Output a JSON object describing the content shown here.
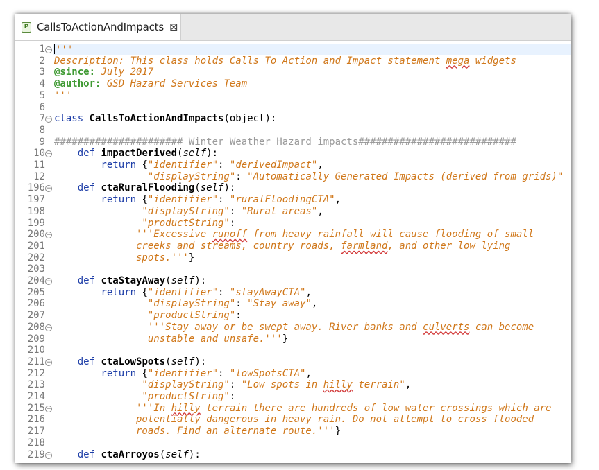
{
  "tab": {
    "title": "CallsToActionAndImpacts",
    "icon": "P",
    "close": "⊠"
  },
  "lines": [
    {
      "n": "1",
      "fold": true,
      "cur": true,
      "s": [
        {
          "t": "'''",
          "c": "str"
        }
      ]
    },
    {
      "n": "2",
      "s": [
        {
          "t": "Description: This class holds Calls To Action and Impact statement mega widgets",
          "c": "str"
        }
      ]
    },
    {
      "n": "3",
      "s": [
        {
          "t": "@since:",
          "c": "tag"
        },
        {
          "t": " July 2017",
          "c": "str"
        }
      ]
    },
    {
      "n": "4",
      "s": [
        {
          "t": "@author:",
          "c": "tag"
        },
        {
          "t": " GSD Hazard Services Team",
          "c": "str"
        }
      ]
    },
    {
      "n": "5",
      "s": [
        {
          "t": "'''",
          "c": "str"
        }
      ]
    },
    {
      "n": "6",
      "s": []
    },
    {
      "n": "7",
      "fold": true,
      "s": [
        {
          "t": "class ",
          "c": "kw"
        },
        {
          "t": "CallsToActionAndImpacts",
          "c": "fn"
        },
        {
          "t": "(object):",
          "c": "dflt"
        }
      ]
    },
    {
      "n": "8",
      "s": []
    },
    {
      "n": "9",
      "s": [
        {
          "t": "###################### Winter Weather Hazard impacts###########################",
          "c": "cmt"
        }
      ]
    },
    {
      "n": "10",
      "fold": true,
      "s": [
        {
          "t": "    def ",
          "c": "kw"
        },
        {
          "t": "impactDerived",
          "c": "fn"
        },
        {
          "t": "(",
          "c": "dflt"
        },
        {
          "t": "self",
          "c": "prm"
        },
        {
          "t": "):",
          "c": "dflt"
        }
      ]
    },
    {
      "n": "11",
      "s": [
        {
          "t": "        return ",
          "c": "kw"
        },
        {
          "t": "{",
          "c": "dflt"
        },
        {
          "t": "\"identifier\"",
          "c": "str"
        },
        {
          "t": ": ",
          "c": "dflt"
        },
        {
          "t": "\"derivedImpact\"",
          "c": "str"
        },
        {
          "t": ",",
          "c": "dflt"
        }
      ]
    },
    {
      "n": "12",
      "s": [
        {
          "t": "                \"displayString\"",
          "c": "str"
        },
        {
          "t": ": ",
          "c": "dflt"
        },
        {
          "t": "\"Automatically Generated Impacts (derived from grids)\"",
          "c": "str"
        }
      ]
    },
    {
      "n": "196",
      "fold": true,
      "s": [
        {
          "t": "    def ",
          "c": "kw"
        },
        {
          "t": "ctaRuralFlooding",
          "c": "fn"
        },
        {
          "t": "(",
          "c": "dflt"
        },
        {
          "t": "self",
          "c": "prm"
        },
        {
          "t": "):",
          "c": "dflt"
        }
      ]
    },
    {
      "n": "197",
      "s": [
        {
          "t": "        return ",
          "c": "kw"
        },
        {
          "t": "{",
          "c": "dflt"
        },
        {
          "t": "\"identifier\"",
          "c": "str"
        },
        {
          "t": ": ",
          "c": "dflt"
        },
        {
          "t": "\"ruralFloodingCTA\"",
          "c": "str"
        },
        {
          "t": ",",
          "c": "dflt"
        }
      ]
    },
    {
      "n": "198",
      "s": [
        {
          "t": "               \"displayString\"",
          "c": "str"
        },
        {
          "t": ": ",
          "c": "dflt"
        },
        {
          "t": "\"Rural areas\"",
          "c": "str"
        },
        {
          "t": ",",
          "c": "dflt"
        }
      ]
    },
    {
      "n": "199",
      "s": [
        {
          "t": "               \"productString\"",
          "c": "str"
        },
        {
          "t": ":",
          "c": "dflt"
        }
      ]
    },
    {
      "n": "200",
      "fold": true,
      "s": [
        {
          "t": "              '''Excessive runoff from heavy rainfall will cause flooding of small",
          "c": "str"
        }
      ]
    },
    {
      "n": "201",
      "s": [
        {
          "t": "              creeks and streams, country roads, farmland, and other low lying",
          "c": "str"
        }
      ]
    },
    {
      "n": "202",
      "s": [
        {
          "t": "              spots.'''",
          "c": "str"
        },
        {
          "t": "}",
          "c": "dflt"
        }
      ]
    },
    {
      "n": "203",
      "s": []
    },
    {
      "n": "204",
      "fold": true,
      "s": [
        {
          "t": "    def ",
          "c": "kw"
        },
        {
          "t": "ctaStayAway",
          "c": "fn"
        },
        {
          "t": "(",
          "c": "dflt"
        },
        {
          "t": "self",
          "c": "prm"
        },
        {
          "t": "):",
          "c": "dflt"
        }
      ]
    },
    {
      "n": "205",
      "s": [
        {
          "t": "        return ",
          "c": "kw"
        },
        {
          "t": "{",
          "c": "dflt"
        },
        {
          "t": "\"identifier\"",
          "c": "str"
        },
        {
          "t": ": ",
          "c": "dflt"
        },
        {
          "t": "\"stayAwayCTA\"",
          "c": "str"
        },
        {
          "t": ",",
          "c": "dflt"
        }
      ]
    },
    {
      "n": "206",
      "s": [
        {
          "t": "                \"displayString\"",
          "c": "str"
        },
        {
          "t": ": ",
          "c": "dflt"
        },
        {
          "t": "\"Stay away\"",
          "c": "str"
        },
        {
          "t": ",",
          "c": "dflt"
        }
      ]
    },
    {
      "n": "207",
      "s": [
        {
          "t": "                \"productString\"",
          "c": "str"
        },
        {
          "t": ":",
          "c": "dflt"
        }
      ]
    },
    {
      "n": "208",
      "fold": true,
      "s": [
        {
          "t": "                '''Stay away or be swept away. River banks and culverts can become",
          "c": "str"
        }
      ]
    },
    {
      "n": "209",
      "s": [
        {
          "t": "                unstable and unsafe.'''",
          "c": "str"
        },
        {
          "t": "}",
          "c": "dflt"
        }
      ]
    },
    {
      "n": "210",
      "s": []
    },
    {
      "n": "211",
      "fold": true,
      "s": [
        {
          "t": "    def ",
          "c": "kw"
        },
        {
          "t": "ctaLowSpots",
          "c": "fn"
        },
        {
          "t": "(",
          "c": "dflt"
        },
        {
          "t": "self",
          "c": "prm"
        },
        {
          "t": "):",
          "c": "dflt"
        }
      ]
    },
    {
      "n": "212",
      "s": [
        {
          "t": "        return ",
          "c": "kw"
        },
        {
          "t": "{",
          "c": "dflt"
        },
        {
          "t": "\"identifier\"",
          "c": "str"
        },
        {
          "t": ": ",
          "c": "dflt"
        },
        {
          "t": "\"lowSpotsCTA\"",
          "c": "str"
        },
        {
          "t": ",",
          "c": "dflt"
        }
      ]
    },
    {
      "n": "213",
      "s": [
        {
          "t": "               \"displayString\"",
          "c": "str"
        },
        {
          "t": ": ",
          "c": "dflt"
        },
        {
          "t": "\"Low spots in hilly terrain\"",
          "c": "str"
        },
        {
          "t": ",",
          "c": "dflt"
        }
      ]
    },
    {
      "n": "214",
      "s": [
        {
          "t": "               \"productString\"",
          "c": "str"
        },
        {
          "t": ":",
          "c": "dflt"
        }
      ]
    },
    {
      "n": "215",
      "fold": true,
      "s": [
        {
          "t": "              '''In hilly terrain there are hundreds of low water crossings which are",
          "c": "str"
        }
      ]
    },
    {
      "n": "216",
      "s": [
        {
          "t": "              potentially dangerous in heavy rain. Do not attempt to cross flooded",
          "c": "str"
        }
      ]
    },
    {
      "n": "217",
      "s": [
        {
          "t": "              roads. Find an alternate route.'''",
          "c": "str"
        },
        {
          "t": "}",
          "c": "dflt"
        }
      ]
    },
    {
      "n": "218",
      "s": []
    },
    {
      "n": "219",
      "fold": true,
      "s": [
        {
          "t": "    def ",
          "c": "kw"
        },
        {
          "t": "ctaArroyos",
          "c": "fn"
        },
        {
          "t": "(",
          "c": "dflt"
        },
        {
          "t": "self",
          "c": "prm"
        },
        {
          "t": "):",
          "c": "dflt"
        }
      ]
    }
  ],
  "colors": {
    "keyword": "#1f3fa8",
    "string": "#d0781b",
    "docTag": "#3f9a33",
    "comment": "#9a9a9a",
    "lineNumber": "#787878",
    "currentLine": "#e8f2fe"
  }
}
